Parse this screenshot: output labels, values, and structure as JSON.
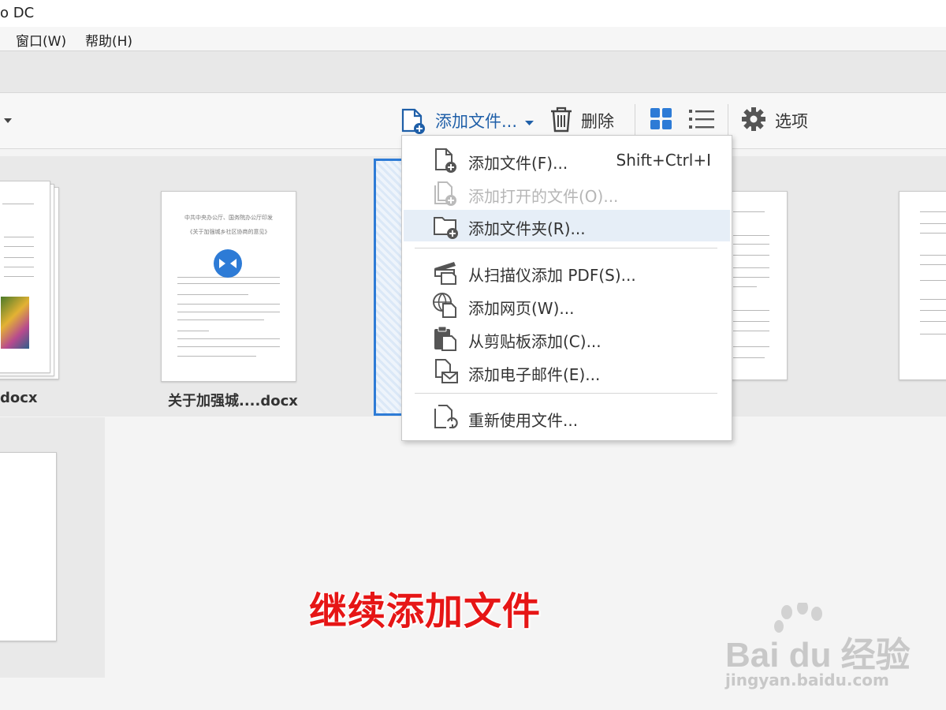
{
  "window": {
    "title": "o DC"
  },
  "menubar": {
    "window": "窗口(W)",
    "help": "帮助(H)"
  },
  "toolbar": {
    "add_files": "添加文件...",
    "delete": "删除",
    "options": "选项"
  },
  "files": [
    {
      "name": "docx"
    },
    {
      "name": "关于加强城....docx"
    }
  ],
  "doc_preview": {
    "heading1": "中共中央办公厅、国务院办公厅印发",
    "heading2": "《关于加强城乡社区协商的意见》"
  },
  "dropdown": {
    "items": [
      {
        "label": "添加文件(F)...",
        "shortcut": "Shift+Ctrl+I",
        "icon": "add-file-icon",
        "enabled": true
      },
      {
        "label": "添加打开的文件(O)...",
        "icon": "add-open-files-icon",
        "enabled": false
      },
      {
        "label": "添加文件夹(R)...",
        "icon": "add-folder-icon",
        "enabled": true,
        "highlighted": true
      },
      {
        "label": "从扫描仪添加 PDF(S)...",
        "icon": "scanner-icon",
        "enabled": true
      },
      {
        "label": "添加网页(W)...",
        "icon": "web-page-icon",
        "enabled": true
      },
      {
        "label": "从剪贴板添加(C)...",
        "icon": "clipboard-icon",
        "enabled": true
      },
      {
        "label": "添加电子邮件(E)...",
        "icon": "email-icon",
        "enabled": true
      },
      {
        "label": "重新使用文件...",
        "icon": "reuse-files-icon",
        "enabled": true
      }
    ]
  },
  "caption": "继续添加文件",
  "watermark": {
    "brand": "Bai du 经验",
    "url": "jingyan.baidu.com"
  },
  "colors": {
    "accent": "#2d7bd6",
    "icon_blue": "#1f5fa8",
    "caption_red": "#e61616"
  }
}
